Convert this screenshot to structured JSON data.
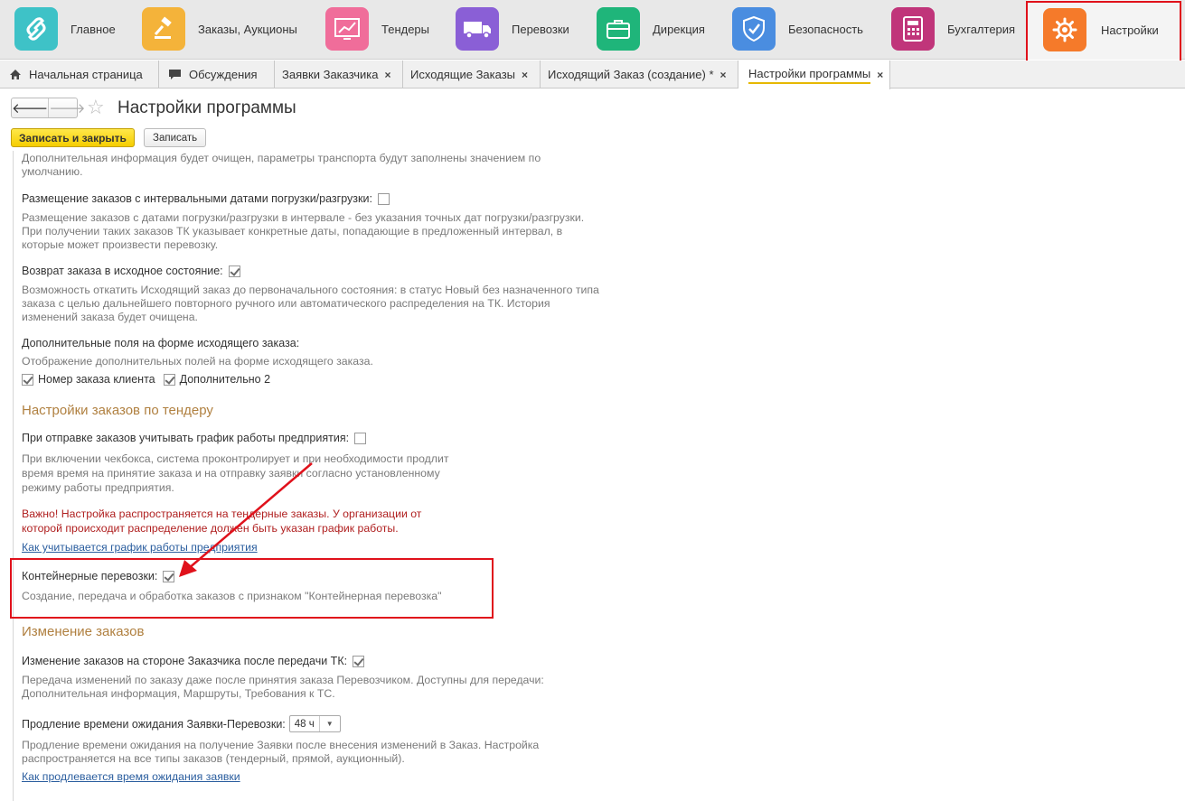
{
  "sections": [
    {
      "label": "Главное",
      "icon": "logo-icon",
      "color": "#3ec2c7"
    },
    {
      "label": "Заказы, Аукционы",
      "icon": "gavel-icon",
      "color": "#f4b33a"
    },
    {
      "label": "Тендеры",
      "icon": "chart-icon",
      "color": "#f06d9a"
    },
    {
      "label": "Перевозки",
      "icon": "truck-icon",
      "color": "#8a5fd6"
    },
    {
      "label": "Дирекция",
      "icon": "briefcase-icon",
      "color": "#1fb57a"
    },
    {
      "label": "Безопасность",
      "icon": "shield-icon",
      "color": "#4a8de0"
    },
    {
      "label": "Бухгалтерия",
      "icon": "calculator-icon",
      "color": "#c0357a"
    },
    {
      "label": "Настройки",
      "icon": "gear-icon",
      "color": "#f57a2a"
    }
  ],
  "tabs": [
    {
      "label": "Начальная страница",
      "icon": "home-icon"
    },
    {
      "label": "Обсуждения",
      "icon": "chat-icon"
    },
    {
      "label": "Заявки Заказчика",
      "closable": true
    },
    {
      "label": "Исходящие Заказы",
      "closable": true
    },
    {
      "label": "Исходящий Заказ (создание) *",
      "closable": true
    },
    {
      "label": "Настройки программы",
      "closable": true,
      "active": true
    }
  ],
  "tab_close_glyph": "×",
  "form": {
    "back_glyph": "🡐",
    "forward_glyph": "🡒",
    "star_glyph": "☆",
    "title": "Настройки программы",
    "save_close_label": "Записать и закрыть",
    "save_label": "Записать"
  },
  "content": {
    "top_desc": "Дополнительная информация будет очищен, параметры транспорта будут заполнены значением по умолчанию.",
    "interval": {
      "label": "Размещение заказов с интервальными датами погрузки/разгрузки:",
      "checked": false,
      "desc": "Размещение заказов с датами погрузки/разгрузки в интервале - без указания точных дат погрузки/разгрузки. При получении таких заказов ТК указывает конкретные даты, попадающие в предложенный интервал, в которые может произвести перевозку."
    },
    "revert": {
      "label": "Возврат заказа в исходное состояние:",
      "checked": true,
      "desc": "Возможность откатить Исходящий заказ до первоначального состояния: в статус Новый без назначенного типа заказа с целью дальнейшего повторного ручного или автоматического распределения на ТК. История изменений заказа будет очищена."
    },
    "extra_fields": {
      "label": "Дополнительные поля на форме исходящего заказа:",
      "desc": "Отображение дополнительных полей на форме исходящего заказа.",
      "options": [
        {
          "label": "Номер заказа клиента",
          "checked": true
        },
        {
          "label": "Дополнительно 2",
          "checked": true
        }
      ]
    },
    "group_tender": "Настройки заказов по тендеру",
    "schedule": {
      "label": "При отправке заказов учитывать график работы предприятия:",
      "checked": false,
      "desc": "При включении чекбокса, система проконтролирует и при необходимости продлит время время на принятие заказа и на отправку заявки согласно установленному режиму работы предприятия.",
      "warning": "Важно! Настройка распространяется на тендерные заказы. У организации от которой происходит распределение должен быть указан график работы.",
      "link": "Как учитывается график работы предприятия"
    },
    "container": {
      "label": "Контейнерные перевозки:",
      "checked": true,
      "desc": "Создание, передача и обработка заказов с признаком \"Контейнерная перевозка\""
    },
    "group_changes": "Изменение заказов",
    "change_after": {
      "label": "Изменение заказов на стороне Заказчика после передачи ТК:",
      "checked": true,
      "desc": "Передача изменений по заказу даже после принятия заказа Перевозчиком. Доступны для передачи: Дополнительная информация, Маршруты, Требования к ТС."
    },
    "wait_time": {
      "label": "Продление времени ожидания Заявки-Перевозки:",
      "value": "48 ч",
      "arrow": "▼",
      "desc": "Продление времени ожидания на получение Заявки после внесения изменений в Заказ. Настройка распространяется на все типы заказов (тендерный, прямой, аукционный).",
      "link": "Как продлевается время ожидания заявки"
    }
  },
  "annotation_color": "#e0111b"
}
